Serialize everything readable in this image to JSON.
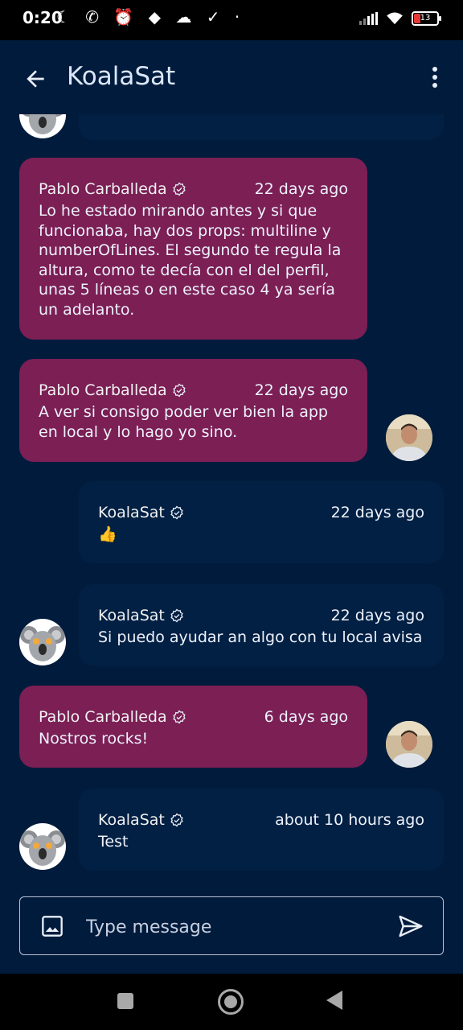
{
  "status_bar": {
    "time": "0:20",
    "battery": "13"
  },
  "app_bar": {
    "title": "KoalaSat"
  },
  "messages": [
    {
      "author": "Pablo Carballeda",
      "time": "22 days ago",
      "text": "Lo he estado mirando antes y si que funcionaba, hay dos props: multiline y numberOfLines. El segundo te regula la altura, como te decía con el del perfil, unas 5 líneas o en este caso 4 ya sería un adelanto."
    },
    {
      "author": "Pablo Carballeda",
      "time": "22 days ago",
      "text": "A ver si consigo poder ver bien la app en local y lo hago yo sino."
    },
    {
      "author": "KoalaSat",
      "time": "22 days ago",
      "text": "👍"
    },
    {
      "author": "KoalaSat",
      "time": "22 days ago",
      "text": "Si puedo ayudar an algo con tu local avisa"
    },
    {
      "author": "Pablo Carballeda",
      "time": "6 days ago",
      "text": "Nostros rocks!"
    },
    {
      "author": "KoalaSat",
      "time": "about 10 hours ago",
      "text": "Test"
    }
  ],
  "composer": {
    "placeholder": "Type message"
  },
  "colors": {
    "background": "#011b3c",
    "mine_bubble": "#022044",
    "their_bubble": "#7b1f55"
  },
  "icons": {
    "back": "arrow-left",
    "menu": "more-vertical",
    "image": "image",
    "send": "send",
    "verified": "verified-badge"
  }
}
